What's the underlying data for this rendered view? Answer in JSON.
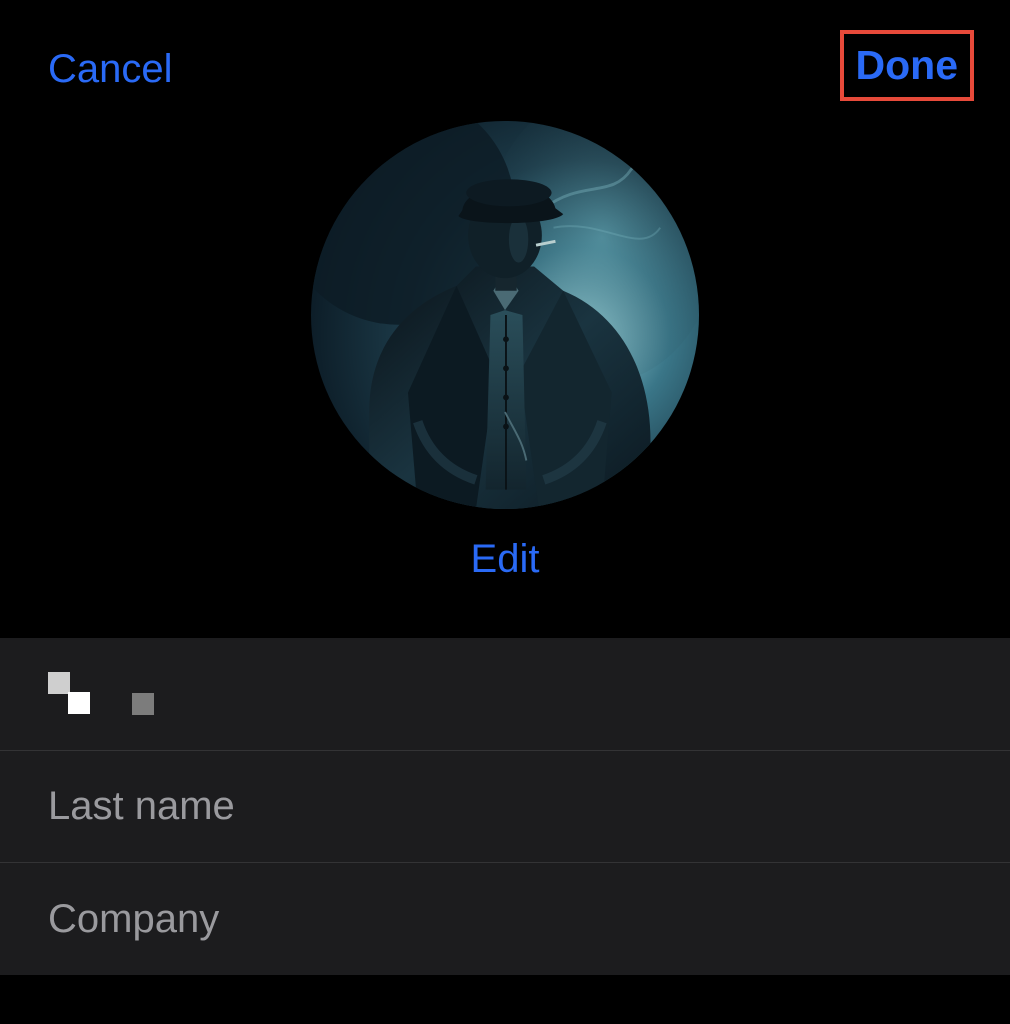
{
  "header": {
    "cancel_label": "Cancel",
    "done_label": "Done"
  },
  "avatar": {
    "edit_label": "Edit"
  },
  "form": {
    "first_name": {
      "value": "",
      "placeholder": "First name"
    },
    "last_name": {
      "value": "",
      "placeholder": "Last name"
    },
    "company": {
      "value": "",
      "placeholder": "Company"
    }
  },
  "colors": {
    "accent": "#2a6af6",
    "highlight_border": "#e74a3a",
    "panel_background": "#1c1c1e",
    "placeholder": "#9a9a9e"
  }
}
